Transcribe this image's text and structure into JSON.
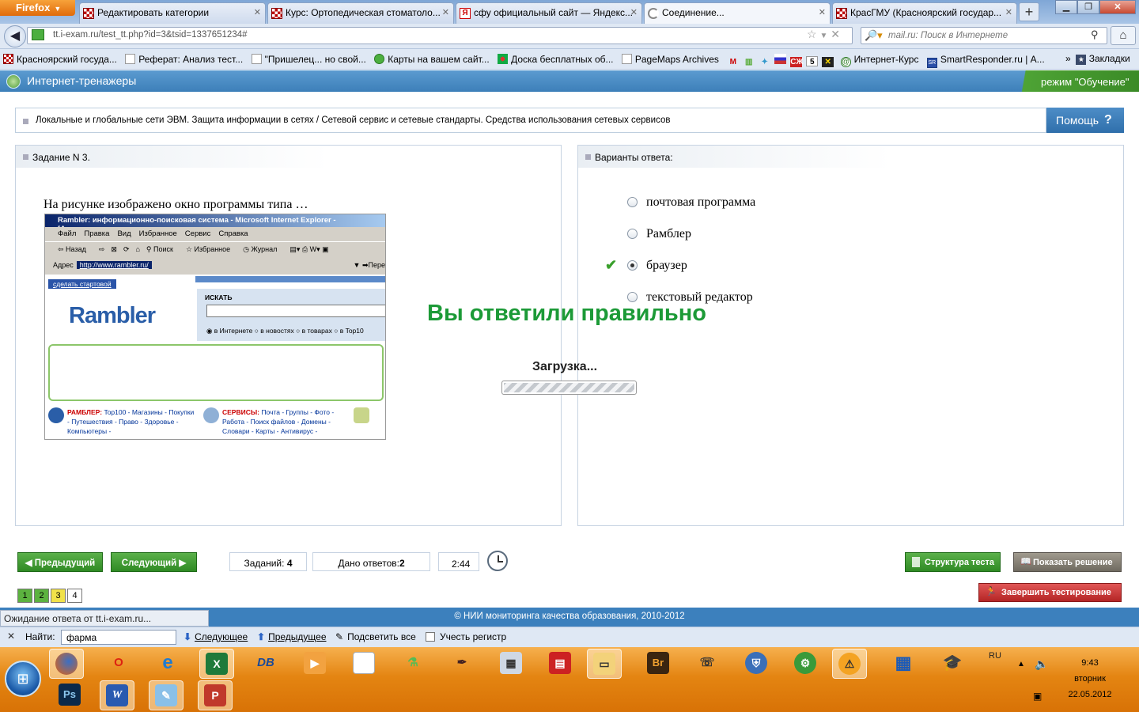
{
  "browser": {
    "app_button": "Firefox",
    "tabs": [
      {
        "label": "Редактировать категории"
      },
      {
        "label": "Курс: Ортопедическая стоматоло..."
      },
      {
        "label": "сфу официальный сайт — Яндекс..."
      },
      {
        "label": "Соединение..."
      },
      {
        "label": "КрасГМУ (Красноярский государ..."
      }
    ],
    "url": "tt.i-exam.ru/test_tt.php?id=3&tsid=1337651234#",
    "search_placeholder": "mail.ru: Поиск в Интернете",
    "bookmarks": [
      "Красноярский госуда...",
      "Реферат: Анализ тест...",
      "\"Пришелец... но свой...",
      "Карты на вашем сайт...",
      "Доска бесплатных об...",
      "PageMaps Archives",
      "Интернет-Курс",
      "SmartResponder.ru | А..."
    ],
    "bookmarks_menu": "Закладки"
  },
  "site": {
    "title": "Интернет-тренажеры",
    "mode": "режим \"Обучение\"",
    "topic": "Локальные и глобальные сети ЭВМ. Защита информации в сетях / Сетевой сервис и сетевые стандарты. Средства использования сетевых сервисов",
    "help_label": "Помощь",
    "help_icon": "?"
  },
  "task": {
    "header": "Задание N 3.",
    "question": "На рисунке изображено окно программы типа …",
    "image": {
      "title": "Rambler: информационно-поисковая система - Microsoft Internet Explorer - [Автономная",
      "menu": [
        "Файл",
        "Правка",
        "Вид",
        "Избранное",
        "Сервис",
        "Справка"
      ],
      "tools": [
        "Назад",
        "Поиск",
        "Избранное",
        "Журнал"
      ],
      "address_label": "Адрес",
      "address": "http://www.rambler.ru/",
      "go_label": "Пере",
      "make_start": "сделать стартовой",
      "logo": "Rambler",
      "search_label": "ИСКАТЬ",
      "radios": [
        "в Интернете",
        "в новостях",
        "в товарах",
        "в Top10"
      ],
      "rambler_links_title": "РАМБЛЕР:",
      "rambler_links": "Top100 - Магазины - Покупки - Путешествия - Право - Здоровье - Компьютеры -",
      "services_title": "СЕРВИСЫ:",
      "services_links": "Почта - Группы - Фото - Работа - Поиск файлов - Домены - Словари - Карты - Антивирус -"
    }
  },
  "answers": {
    "header": "Варианты ответа:",
    "options": [
      {
        "label": "почтовая программа",
        "selected": false
      },
      {
        "label": "Рамблер",
        "selected": false
      },
      {
        "label": "браузер",
        "selected": true
      },
      {
        "label": "текстовый редактор",
        "selected": false
      }
    ]
  },
  "overlay": {
    "result": "Вы ответили правильно",
    "loading": "Загрузка..."
  },
  "controls": {
    "prev": "Предыдущий",
    "next": "Следующий",
    "tasks_label": "Заданий:",
    "tasks_value": "4",
    "answered_label": "Дано ответов:",
    "answered_value": "2",
    "time": "2:44",
    "structure": "Структура теста",
    "show_solution": "Показать решение",
    "finish": "Завершить тестирование",
    "pages": [
      {
        "label": "1",
        "color": "#5cb23f"
      },
      {
        "label": "2",
        "color": "#5cb23f"
      },
      {
        "label": "3",
        "color": "#f1e24a"
      },
      {
        "label": "4",
        "color": "#ffffff"
      }
    ]
  },
  "footer": "© НИИ мониторинга качества образования, 2010-2012",
  "status": "Ожидание ответа от tt.i-exam.ru...",
  "findbar": {
    "label": "Найти:",
    "value": "фарма",
    "next": "Следующее",
    "prev": "Предыдущее",
    "highlight": "Подсветить все",
    "case": "Учесть регистр"
  },
  "taskbar": {
    "lang": "RU",
    "time": "9:43",
    "day": "вторник",
    "date": "22.05.2012"
  }
}
